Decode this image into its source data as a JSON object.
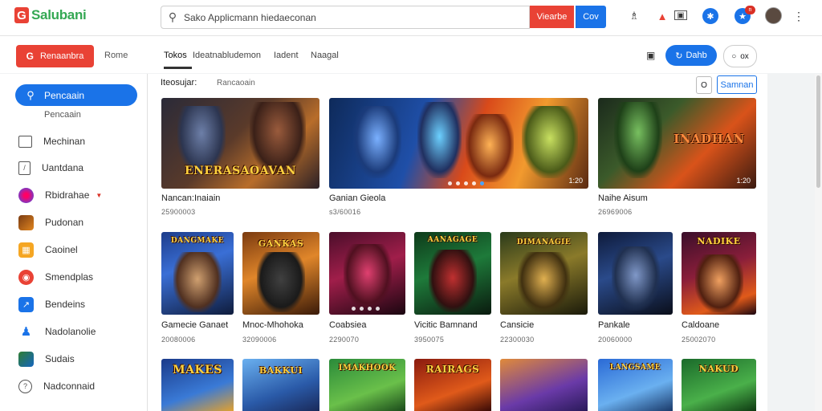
{
  "header": {
    "logo_mark": "G",
    "logo_text": "Salubani",
    "search_placeholder": "Sako Applicmann hiedaeconan",
    "search_button": "Viearbe",
    "go_button": "Cov"
  },
  "toolbar": {
    "create_button": "Renaanbra",
    "create_icon": "G",
    "home_link": "Rome",
    "tabs": [
      {
        "label": "Tokos"
      },
      {
        "label": "Ideatnabludemon"
      },
      {
        "label": "Iadent"
      },
      {
        "label": "Naagal"
      }
    ],
    "pill_blue": "Dahb",
    "pill_white": "ox"
  },
  "notification_badge": "n",
  "sidebar": {
    "active_label": "Pencaain",
    "sub_label": "Pencaain",
    "items": [
      {
        "label": "Mechinan",
        "icon": "square-icon"
      },
      {
        "label": "Uantdana",
        "icon": "document-icon"
      },
      {
        "label": "Rbidrahae",
        "icon": "game-avatar-icon"
      },
      {
        "label": "Pudonan",
        "icon": "game-avatar-icon"
      },
      {
        "label": "Caoinel",
        "icon": "grid-icon"
      },
      {
        "label": "Smendplas",
        "icon": "game-avatar-icon"
      },
      {
        "label": "Bendeins",
        "icon": "chart-icon"
      },
      {
        "label": "Nadolanolie",
        "icon": "figure-icon"
      },
      {
        "label": "Sudais",
        "icon": "game-avatar-icon"
      },
      {
        "label": "Nadconnaid",
        "icon": "info-circle-icon"
      }
    ]
  },
  "main": {
    "breadcrumb_primary": "Iteosujar:",
    "breadcrumb_secondary": "Rancaoain",
    "ctrl_small": "O",
    "ctrl_button": "Samnan",
    "featured": [
      {
        "title": "Nancan:Inaiain",
        "meta": "25900003",
        "caption": "ENERASAOAVAN"
      },
      {
        "title": "Ganian Gieola",
        "meta": "s3/60016",
        "caption": "",
        "counter": "1:20"
      },
      {
        "title": "Naihe Aisum",
        "meta": "26969006",
        "caption": "INADHAN",
        "counter": "1:20"
      }
    ],
    "row2": [
      {
        "title": "Gamecie Ganaet",
        "meta": "20080006",
        "caption": "DANGMAKE"
      },
      {
        "title": "Mnoc-Mhohoka",
        "meta": "32090006",
        "caption": "GANKAS"
      },
      {
        "title": "Coabsiea",
        "meta": "2290070",
        "caption": ""
      },
      {
        "title": "Vicitic Bamnand",
        "meta": "3950075",
        "caption": "AANAGAGE"
      },
      {
        "title": "Cansicie",
        "meta": "22300030",
        "caption": "DIMANAGIE"
      },
      {
        "title": "Pankale",
        "meta": "20060000",
        "caption": ""
      },
      {
        "title": "Caldoane",
        "meta": "25002070",
        "caption": "NADIKE"
      }
    ],
    "row3": [
      {
        "caption": "MAKES"
      },
      {
        "caption": "BAKKUI"
      },
      {
        "caption": "IMAKHOOK"
      },
      {
        "caption": "RAIRAGS"
      },
      {
        "caption": ""
      },
      {
        "caption": "LANGSAME"
      },
      {
        "caption": "NAKUD"
      }
    ]
  }
}
